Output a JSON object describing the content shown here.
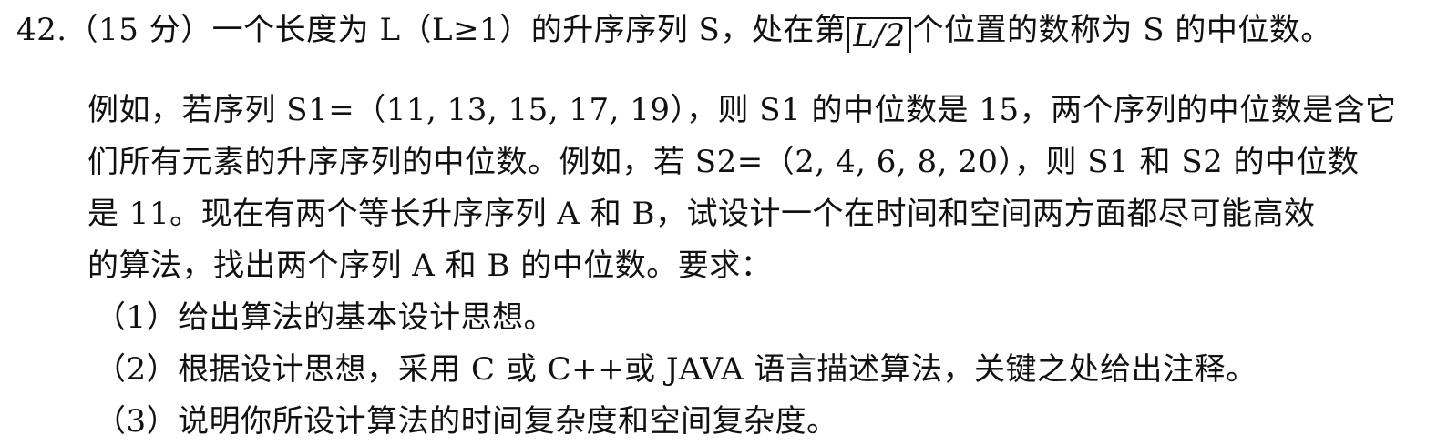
{
  "question": {
    "prefix": "42.（15 分）一个长度为 L（L≥1）的升序序列 S，处在第",
    "ceil_expr": "L/2",
    "suffix": "个位置的数称为 S 的中位数。"
  },
  "paragraph": {
    "line1": "例如，若序列 S1=（11, 13, 15, 17, 19），则 S1 的中位数是 15，两个序列的中位数是含它",
    "line2": "们所有元素的升序序列的中位数。例如，若 S2=（2, 4, 6, 8, 20），则 S1 和 S2 的中位数",
    "line3": "是 11。现在有两个等长升序序列 A 和 B，试设计一个在时间和空间两方面都尽可能高效",
    "line4": "的算法，找出两个序列 A 和 B 的中位数。要求："
  },
  "requirements": [
    "（1）给出算法的基本设计思想。",
    "（2）根据设计思想，采用 C 或 C++或 JAVA 语言描述算法，关键之处给出注释。",
    "（3）说明你所设计算法的时间复杂度和空间复杂度。"
  ]
}
